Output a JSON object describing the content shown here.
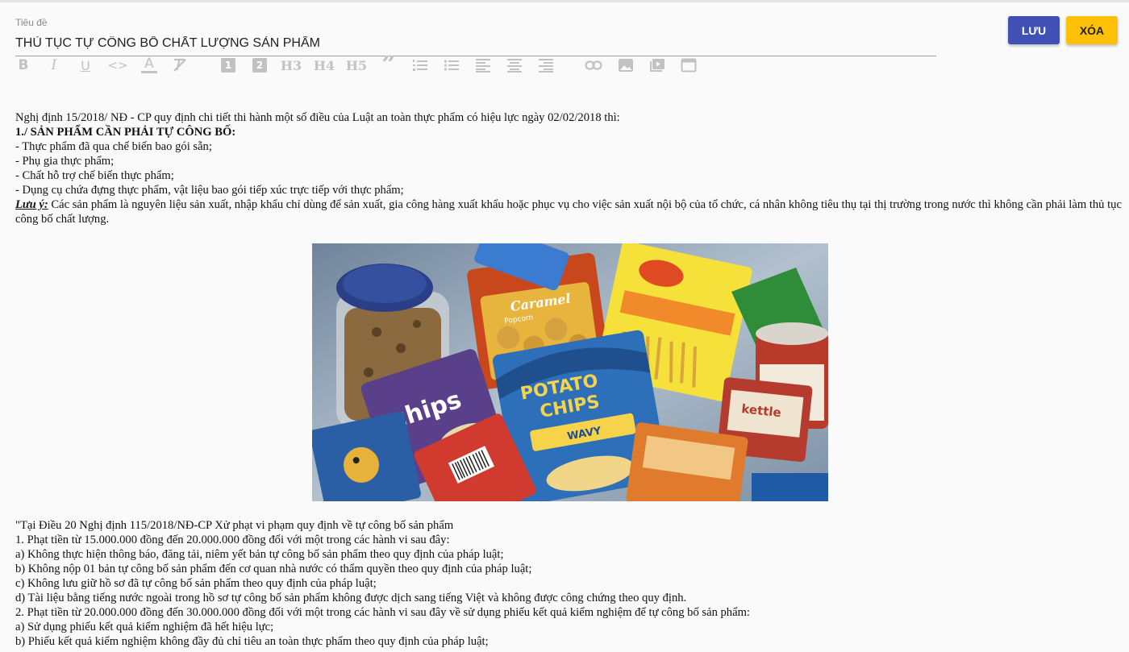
{
  "header": {
    "title_label": "Tiêu đề",
    "title_value": "THỦ TỤC TỰ CÔNG BỐ CHẤT LƯỢNG SẢN PHẨM",
    "save_label": "LƯU",
    "delete_label": "XÓA"
  },
  "toolbar": {
    "h3": "H3",
    "h4": "H4",
    "h5": "H5",
    "quote": "”",
    "h1_badge": "1",
    "h2_badge": "2",
    "bold": "B",
    "italic": "I",
    "underline": "U",
    "code": "<>",
    "text_color": "A"
  },
  "article": {
    "intro": "Nghị định 15/2018/ NĐ - CP quy định chi tiết thi hành một số điều của Luật an toàn thực phẩm có hiệu lực ngày 02/02/2018 thì:",
    "heading1": "1./ SẢN PHẨM CẦN PHẢI TỰ CÔNG BỐ:",
    "items": [
      "- Thực phẩm đã qua chế biến bao gói sẵn;",
      "- Phụ gia thực phẩm;",
      "- Chất hỗ trợ chế biến thực phẩm;",
      "- Dụng cụ chứa đựng thực phẩm, vật liệu bao gói tiếp xúc trực tiếp với thực phẩm;"
    ],
    "note_label": "Lưu ý:",
    "note_text": " Các sản phẩm là nguyên liệu sản xuất, nhập khẩu chỉ dùng để sản xuất, gia công hàng xuất khẩu hoặc phục vụ cho việc sản xuất nội bộ của tổ chức, cá nhân không tiêu thụ tại thị trường trong nước thì không cần phải làm thủ tục công bố chất lượng.",
    "image_texts": {
      "caramel": "Caramel",
      "caramel_sub": "Popcorn",
      "potato": "POTATO",
      "chips": "CHIPS",
      "wavy": "WAVY",
      "chips_brand": "chips",
      "kettle": "kettle"
    },
    "heading2": "\"Tại Điều 20 Nghị định 115/2018/NĐ-CP Xử phạt vi phạm quy định về tự công bố sản phẩm",
    "penalty_lines": [
      "1. Phạt tiền từ 15.000.000 đồng đến 20.000.000 đồng đối với một trong các hành vi sau đây:",
      "a) Không thực hiện thông báo, đăng tải, niêm yết bản tự công bố sản phẩm theo quy định của pháp luật;",
      "b) Không nộp 01 bản tự công bố sản phẩm đến cơ quan nhà nước có thẩm quyền theo quy định của pháp luật;",
      "c) Không lưu giữ hồ sơ đã tự công bố sản phẩm theo quy định của pháp luật;",
      "d) Tài liệu bằng tiếng nước ngoài trong hồ sơ tự công bố sản phẩm không được dịch sang tiếng Việt và không được công chứng theo quy định.",
      "2. Phạt tiền từ 20.000.000 đồng đến 30.000.000 đồng đối với một trong các hành vi sau đây về sử dụng phiếu kết quả kiểm nghiệm để tự công bố sản phẩm:",
      "a) Sử dụng phiếu kết quả kiểm nghiệm đã hết hiệu lực;",
      "b) Phiếu kết quả kiểm nghiệm không đầy đủ chỉ tiêu an toàn thực phẩm theo quy định của pháp luật;"
    ]
  },
  "colors": {
    "primary": "#3f51b5",
    "accent": "#ffc107",
    "toolbar_icon": "#c2c2c2"
  }
}
